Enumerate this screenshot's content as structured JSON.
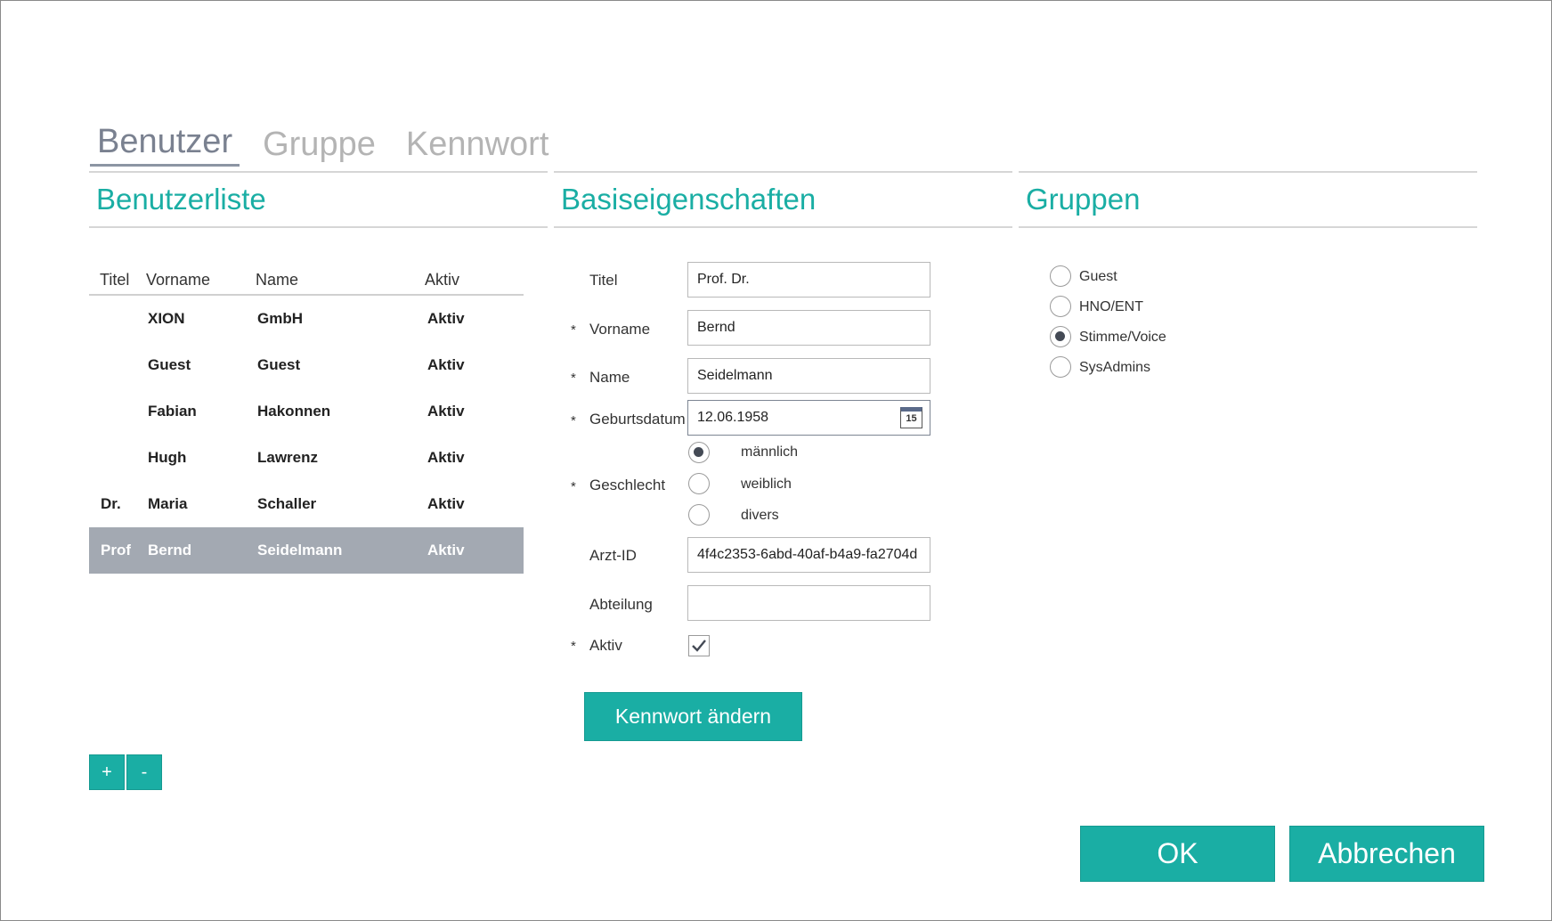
{
  "tabs": [
    "Benutzer",
    "Gruppe",
    "Kennwort"
  ],
  "sections": {
    "users": "Benutzerliste",
    "basic": "Basiseigenschaften",
    "groups": "Gruppen"
  },
  "user_table": {
    "headers": {
      "titel": "Titel",
      "vorname": "Vorname",
      "name": "Name",
      "aktiv": "Aktiv"
    },
    "rows": [
      {
        "titel": "",
        "vorname": "XION",
        "name": "GmbH",
        "aktiv": "Aktiv"
      },
      {
        "titel": "",
        "vorname": "Guest",
        "name": "Guest",
        "aktiv": "Aktiv"
      },
      {
        "titel": "",
        "vorname": "Fabian",
        "name": "Hakonnen",
        "aktiv": "Aktiv"
      },
      {
        "titel": "",
        "vorname": "Hugh",
        "name": "Lawrenz",
        "aktiv": "Aktiv"
      },
      {
        "titel": "Dr.",
        "vorname": "Maria",
        "name": "Schaller",
        "aktiv": "Aktiv"
      },
      {
        "titel": "Prof",
        "vorname": "Bernd",
        "name": "Seidelmann",
        "aktiv": "Aktiv"
      }
    ],
    "selected_index": 5
  },
  "list_buttons": {
    "add": "+",
    "remove": "-"
  },
  "form": {
    "required_mark": "*",
    "titel_label": "Titel",
    "titel_value": "Prof. Dr.",
    "vorname_label": "Vorname",
    "vorname_value": "Bernd",
    "name_label": "Name",
    "name_value": "Seidelmann",
    "geburtsdatum_label": "Geburtsdatum",
    "geburtsdatum_value": "12.06.1958",
    "calendar_day": "15",
    "geschlecht_label": "Geschlecht",
    "geschlecht_options": [
      "männlich",
      "weiblich",
      "divers"
    ],
    "geschlecht_selected": "männlich",
    "arzt_id_label": "Arzt-ID",
    "arzt_id_value": "4f4c2353-6abd-40af-b4a9-fa2704d",
    "abteilung_label": "Abteilung",
    "abteilung_value": "",
    "aktiv_label": "Aktiv",
    "aktiv_checked": true,
    "change_password_label": "Kennwort ändern"
  },
  "groups": {
    "options": [
      "Guest",
      "HNO/ENT",
      "Stimme/Voice",
      "SysAdmins"
    ],
    "selected": "Stimme/Voice"
  },
  "dialog_buttons": {
    "ok": "OK",
    "cancel": "Abbrechen"
  },
  "colors": {
    "accent": "#1aaea4",
    "selected_row": "#a3a9b2",
    "tab_active": "#7a8190",
    "tab_inactive": "#b4b4b4"
  }
}
